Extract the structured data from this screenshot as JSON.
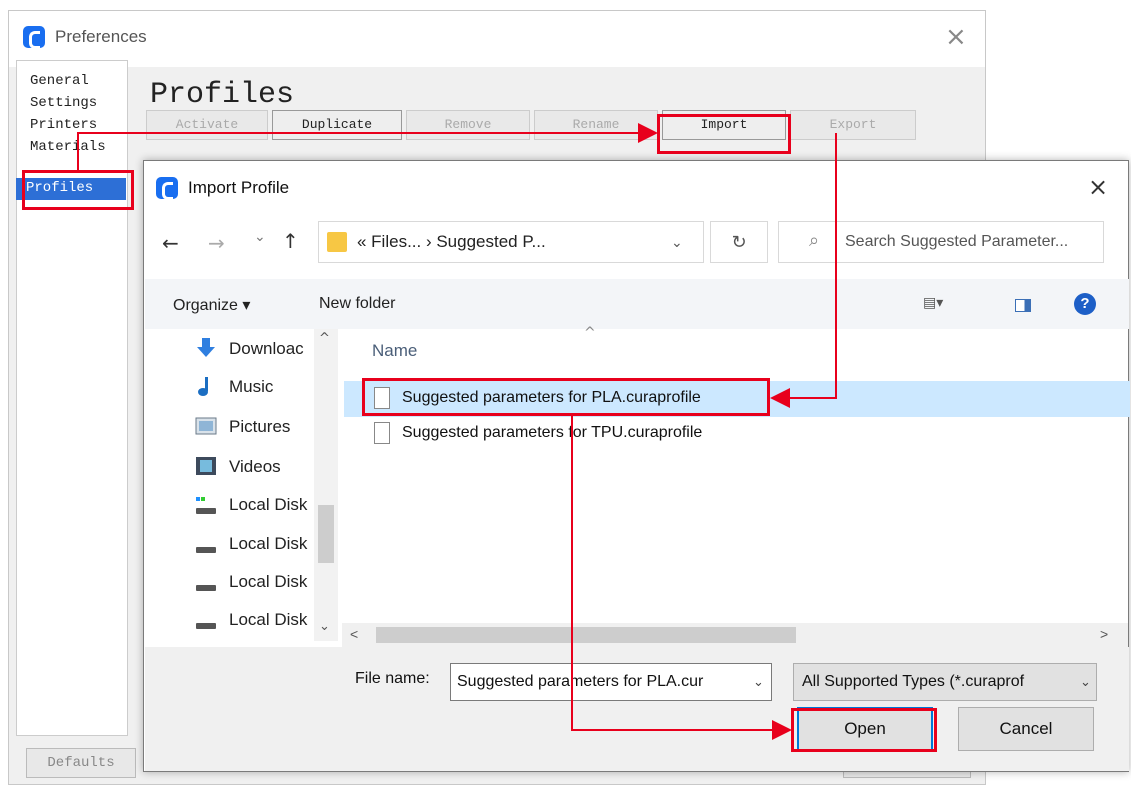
{
  "preferences": {
    "title": "Preferences",
    "close": "×",
    "sidebar": [
      "General",
      "Settings",
      "Printers",
      "Materials",
      "Profiles"
    ],
    "heading": "Profiles",
    "buttons": [
      "Activate",
      "Duplicate",
      "Remove",
      "Rename",
      "Import",
      "Export"
    ],
    "defaults": "Defaults"
  },
  "dialog": {
    "title": "Import Profile",
    "close": "×",
    "nav": {
      "back": "←",
      "forward": "→",
      "recent": "⌄",
      "up": "↑"
    },
    "address": "« Files... › Suggested P...",
    "address_chevron": "⌄",
    "refresh": "↻",
    "search_placeholder": "Search Suggested Parameter...",
    "organize": "Organize ▾",
    "new_folder": "New folder",
    "view_menu": "▤▾",
    "help": "?",
    "nav_items": [
      "Downloac",
      "Music",
      "Pictures",
      "Videos",
      "Local Disk",
      "Local Disk",
      "Local Disk",
      "Local Disk"
    ],
    "column_name": "Name",
    "sort_caret": "^",
    "files": [
      "Suggested parameters for PLA.curaprofile",
      "Suggested parameters for TPU.curaprofile"
    ],
    "file_name_label": "File name:",
    "file_name_value": "Suggested parameters for PLA.cur",
    "file_types": "All Supported Types (*.curaprof",
    "chevron": "⌄",
    "open": "Open",
    "cancel": "Cancel",
    "scroll_up": "^",
    "scroll_down": "⌄",
    "scroll_left": "<",
    "scroll_right": ">"
  },
  "annotation_color": "#e8001c",
  "selection_color": "#cce8ff"
}
